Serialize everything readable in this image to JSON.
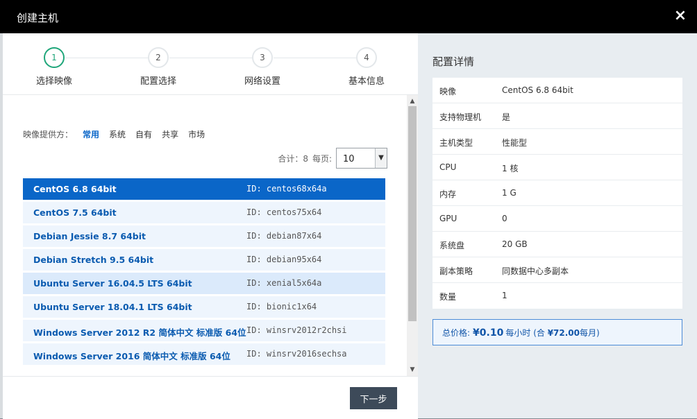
{
  "dialog": {
    "title": "创建主机",
    "close_symbol": "×"
  },
  "steps": [
    {
      "num": "1",
      "label": "选择映像",
      "active": true
    },
    {
      "num": "2",
      "label": "配置选择",
      "active": false
    },
    {
      "num": "3",
      "label": "网络设置",
      "active": false
    },
    {
      "num": "4",
      "label": "基本信息",
      "active": false
    }
  ],
  "provider": {
    "label": "映像提供方：",
    "options": [
      "常用",
      "系统",
      "自有",
      "共享",
      "市场"
    ],
    "active_index": 0
  },
  "pagination": {
    "total_text": "合计：8",
    "per_page_label": "每页:",
    "per_page_value": "10"
  },
  "images": [
    {
      "name": "CentOS 6.8 64bit",
      "id": "ID: centos68x64a"
    },
    {
      "name": "CentOS 7.5 64bit",
      "id": "ID: centos75x64"
    },
    {
      "name": "Debian Jessie 8.7 64bit",
      "id": "ID: debian87x64"
    },
    {
      "name": "Debian Stretch 9.5 64bit",
      "id": "ID: debian95x64"
    },
    {
      "name": "Ubuntu Server 16.04.5 LTS 64bit",
      "id": "ID: xenial5x64a"
    },
    {
      "name": "Ubuntu Server 18.04.1 LTS 64bit",
      "id": "ID: bionic1x64"
    },
    {
      "name": "Windows Server 2012 R2 简体中文 标准版 64位",
      "id": "ID: winsrv2012r2chsi"
    },
    {
      "name": "Windows Server 2016 简体中文 标准版 64位",
      "id": "ID: winsrv2016sechsa"
    }
  ],
  "selected_image_index": 0,
  "hovered_image_index": 4,
  "footer": {
    "next_label": "下一步"
  },
  "details": {
    "title": "配置详情",
    "rows": [
      {
        "key": "映像",
        "value": "CentOS 6.8 64bit"
      },
      {
        "key": "支持物理机",
        "value": "是"
      },
      {
        "key": "主机类型",
        "value": "性能型"
      },
      {
        "key": "CPU",
        "value": "1 核"
      },
      {
        "key": "内存",
        "value": "1 G"
      },
      {
        "key": "GPU",
        "value": "0"
      },
      {
        "key": "系统盘",
        "value": "20 GB"
      },
      {
        "key": "副本策略",
        "value": "同数据中心多副本"
      },
      {
        "key": "数量",
        "value": "1"
      }
    ]
  },
  "price": {
    "label": "总价格:",
    "value": "¥0.10",
    "unit": "每小时",
    "total_prefix": "(合",
    "total_value": "¥72.00",
    "total_suffix": "每月)"
  },
  "colors": {
    "accent": "#0a66c8",
    "step_active": "#1fa67a",
    "titlebar": "#000000",
    "next_button": "#3d4a59"
  },
  "icons": {
    "close": "close-icon",
    "scroll_up": "scroll-up-arrow-icon",
    "scroll_down": "scroll-down-arrow-icon",
    "select_arrow": "chevron-down-icon"
  }
}
